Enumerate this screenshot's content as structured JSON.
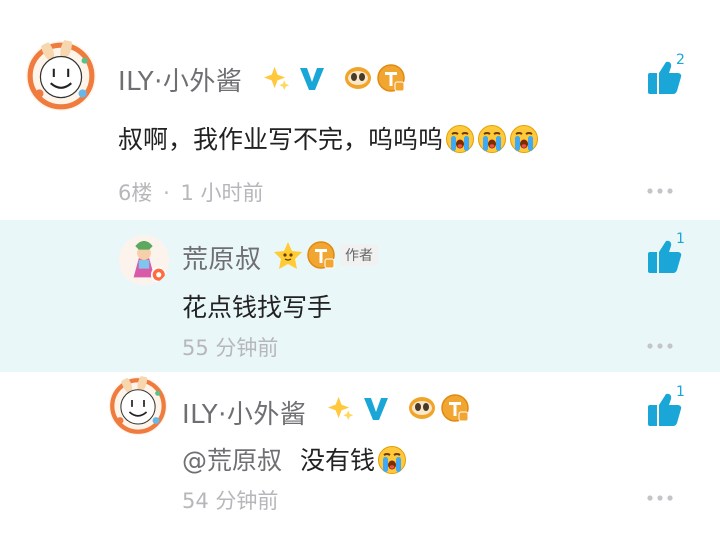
{
  "comments": [
    {
      "user": "ILY·小外酱",
      "text": "叔啊，我作业写不完，呜呜呜",
      "floor": "6楼",
      "sep": "·",
      "time": "1 小时前",
      "likes": "2"
    },
    {
      "user": "荒原叔",
      "author_tag": "作者",
      "text": "花点钱找写手",
      "time": "55 分钟前",
      "likes": "1"
    },
    {
      "user": "ILY·小外酱",
      "mention": "@荒原叔",
      "text": "没有钱",
      "time": "54 分钟前",
      "likes": "1"
    }
  ],
  "icons": {
    "like": "thumbs-up-icon",
    "more": "more-dots-icon",
    "crying": "crying-face-emoji"
  },
  "colors": {
    "accent": "#1aa7d8",
    "reply_bg": "#eaf7f8",
    "name": "#6f6f73",
    "meta": "#b7b7bb"
  }
}
